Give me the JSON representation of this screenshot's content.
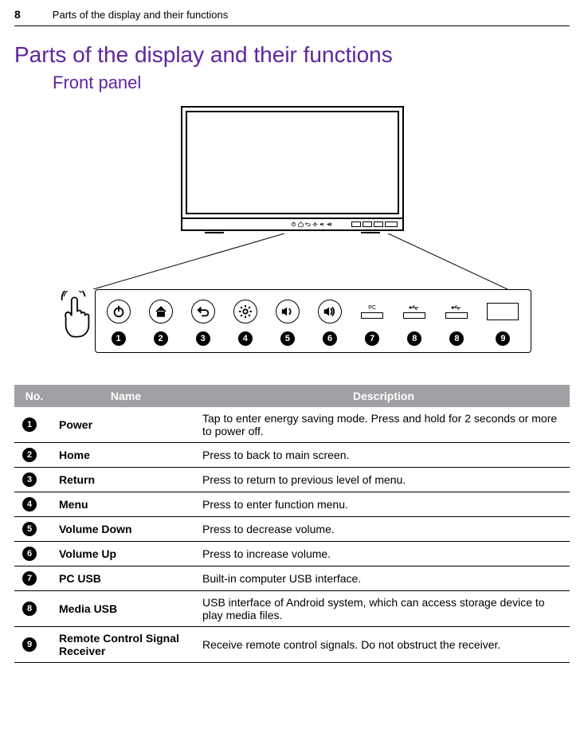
{
  "page_number": "8",
  "header_title": "Parts of the display and their functions",
  "section_title": "Parts of the display and their functions",
  "subsection_title": "Front panel",
  "panel_numbers": [
    "1",
    "2",
    "3",
    "4",
    "5",
    "6",
    "7",
    "8",
    "8",
    "9"
  ],
  "usb_labels": {
    "pc": "PC",
    "media": ""
  },
  "table": {
    "headers": {
      "no": "No.",
      "name": "Name",
      "desc": "Description"
    },
    "rows": [
      {
        "no": "1",
        "name": "Power",
        "desc": "Tap to enter energy saving mode. Press and hold for 2 seconds or more to power off."
      },
      {
        "no": "2",
        "name": "Home",
        "desc": "Press to back to main screen."
      },
      {
        "no": "3",
        "name": "Return",
        "desc": "Press to return to previous level of menu."
      },
      {
        "no": "4",
        "name": "Menu",
        "desc": "Press to enter function menu."
      },
      {
        "no": "5",
        "name": "Volume Down",
        "desc": "Press to decrease volume."
      },
      {
        "no": "6",
        "name": "Volume Up",
        "desc": "Press to increase volume."
      },
      {
        "no": "7",
        "name": "PC USB",
        "desc": "Built-in computer USB interface."
      },
      {
        "no": "8",
        "name": "Media USB",
        "desc": "USB interface of Android system, which can access storage device to play media files."
      },
      {
        "no": "9",
        "name": "Remote Control Signal Receiver",
        "desc": "Receive remote control signals. Do not obstruct the receiver."
      }
    ]
  }
}
